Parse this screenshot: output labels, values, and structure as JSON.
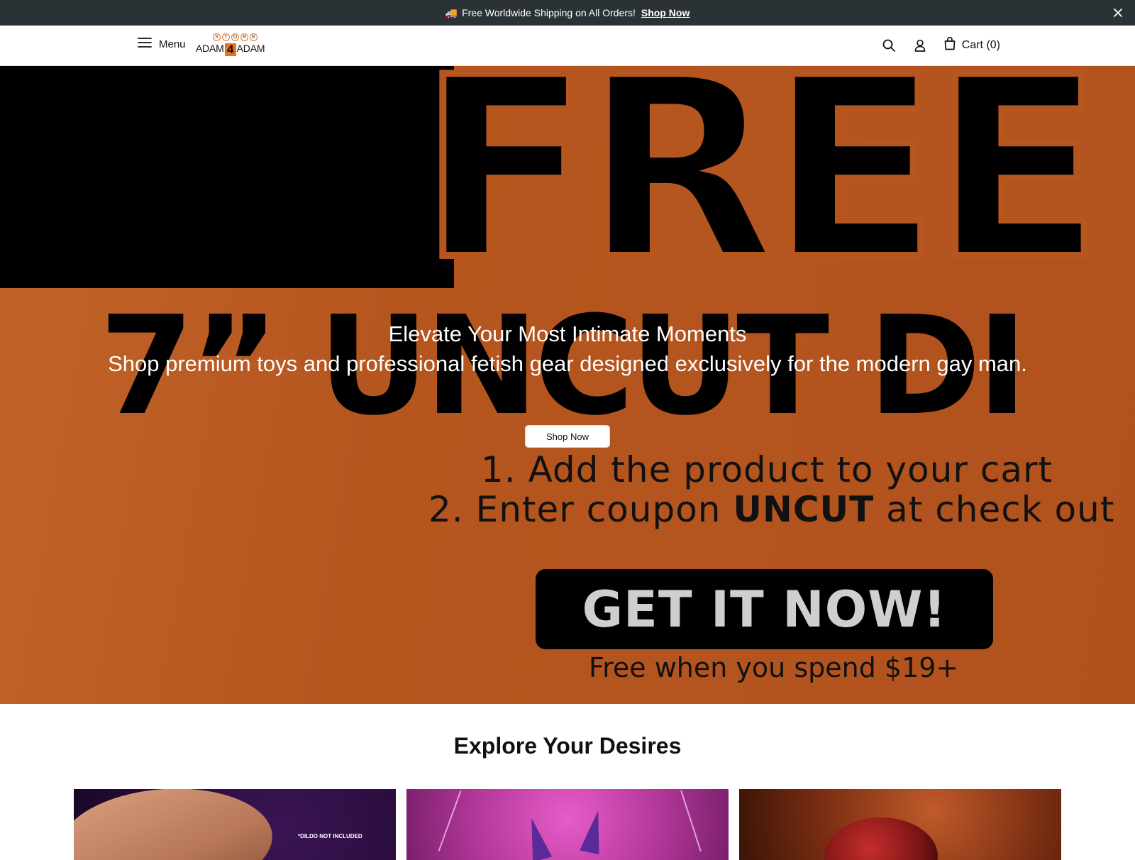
{
  "announcement": {
    "icon": "truck-icon",
    "message": "Free Worldwide Shipping on All Orders!",
    "link_label": "Shop Now"
  },
  "header": {
    "menu_label": "Menu",
    "logo": {
      "top": "STORE",
      "left": "ADAM",
      "mid": "4",
      "right": "ADAM"
    },
    "cart_label": "Cart (0)",
    "accent_color": "#e8731c"
  },
  "hero": {
    "headline_big": "FREE",
    "subheadline_big": "7” UNCUT DI",
    "overlay_title": "Elevate Your Most Intimate Moments",
    "overlay_subtitle": "Shop premium toys and professional fetish gear designed exclusively for the modern gay man.",
    "cta_label": "Shop Now",
    "step1": "1. Add the product to your cart",
    "step2_prefix": "2. Enter coupon ",
    "step2_code": "UNCUT",
    "step2_suffix": " at check out",
    "get_it_label": "GET IT NOW!",
    "spend_note": "Free when you spend $19+",
    "background_color": "#b6561f"
  },
  "explore": {
    "title": "Explore Your Desires",
    "cards": [
      {
        "note": "*DILDO NOT INCLUDED"
      },
      {
        "note": ""
      },
      {
        "note": ""
      }
    ]
  }
}
